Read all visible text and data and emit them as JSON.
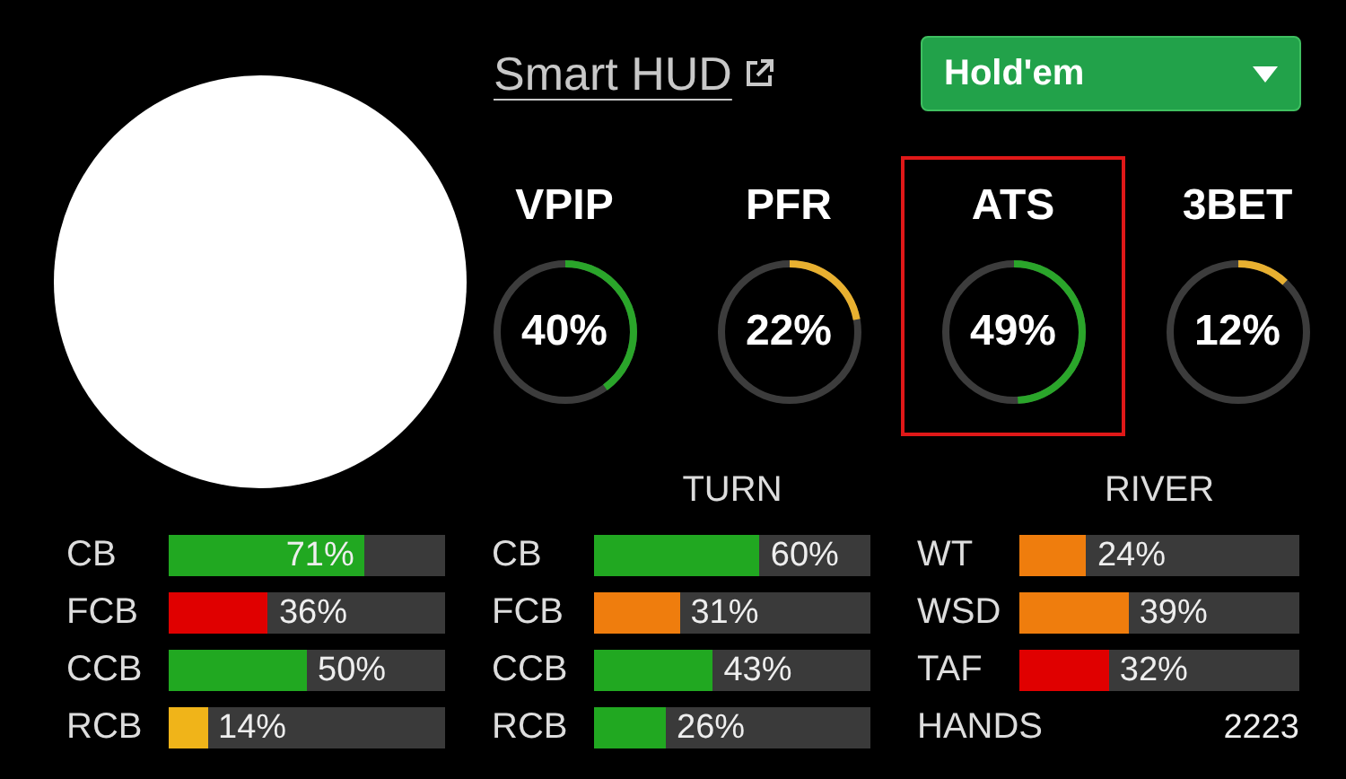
{
  "header": {
    "title": "Smart HUD",
    "game_select": {
      "value": "Hold'em"
    }
  },
  "stats": [
    {
      "label": "VPIP",
      "value": "40%",
      "color": "#2aa52a",
      "selected": false
    },
    {
      "label": "PFR",
      "value": "22%",
      "color": "#e8b030",
      "selected": false
    },
    {
      "label": "ATS",
      "value": "49%",
      "color": "#2aa52a",
      "selected": true
    },
    {
      "label": "3BET",
      "value": "12%",
      "color": "#e8b030",
      "selected": false
    }
  ],
  "sections": [
    {
      "rows": [
        {
          "kind": "bar",
          "label": "CB",
          "value": "71%",
          "level": 0.71,
          "color": "#21a821"
        },
        {
          "kind": "bar",
          "label": "FCB",
          "value": "36%",
          "level": 0.36,
          "color": "#e00000"
        },
        {
          "kind": "bar",
          "label": "CCB",
          "value": "50%",
          "level": 0.5,
          "color": "#21a821"
        },
        {
          "kind": "bar",
          "label": "RCB",
          "value": "14%",
          "level": 0.14,
          "color": "#f0b419"
        }
      ]
    },
    {
      "title": "TURN",
      "rows": [
        {
          "kind": "bar",
          "label": "CB",
          "value": "60%",
          "level": 0.6,
          "color": "#21a821"
        },
        {
          "kind": "bar",
          "label": "FCB",
          "value": "31%",
          "level": 0.31,
          "color": "#ef7d0d"
        },
        {
          "kind": "bar",
          "label": "CCB",
          "value": "43%",
          "level": 0.43,
          "color": "#21a821"
        },
        {
          "kind": "bar",
          "label": "RCB",
          "value": "26%",
          "level": 0.26,
          "color": "#21a821"
        }
      ]
    },
    {
      "title": "RIVER",
      "rows": [
        {
          "kind": "bar",
          "label": "WT",
          "value": "24%",
          "level": 0.24,
          "color": "#ef7d0d"
        },
        {
          "kind": "bar",
          "label": "WSD",
          "value": "39%",
          "level": 0.39,
          "color": "#ef7d0d"
        },
        {
          "kind": "bar",
          "label": "TAF",
          "value": "32%",
          "level": 0.32,
          "color": "#e00000"
        },
        {
          "kind": "count",
          "label": "HANDS",
          "value": "2223"
        }
      ]
    }
  ]
}
